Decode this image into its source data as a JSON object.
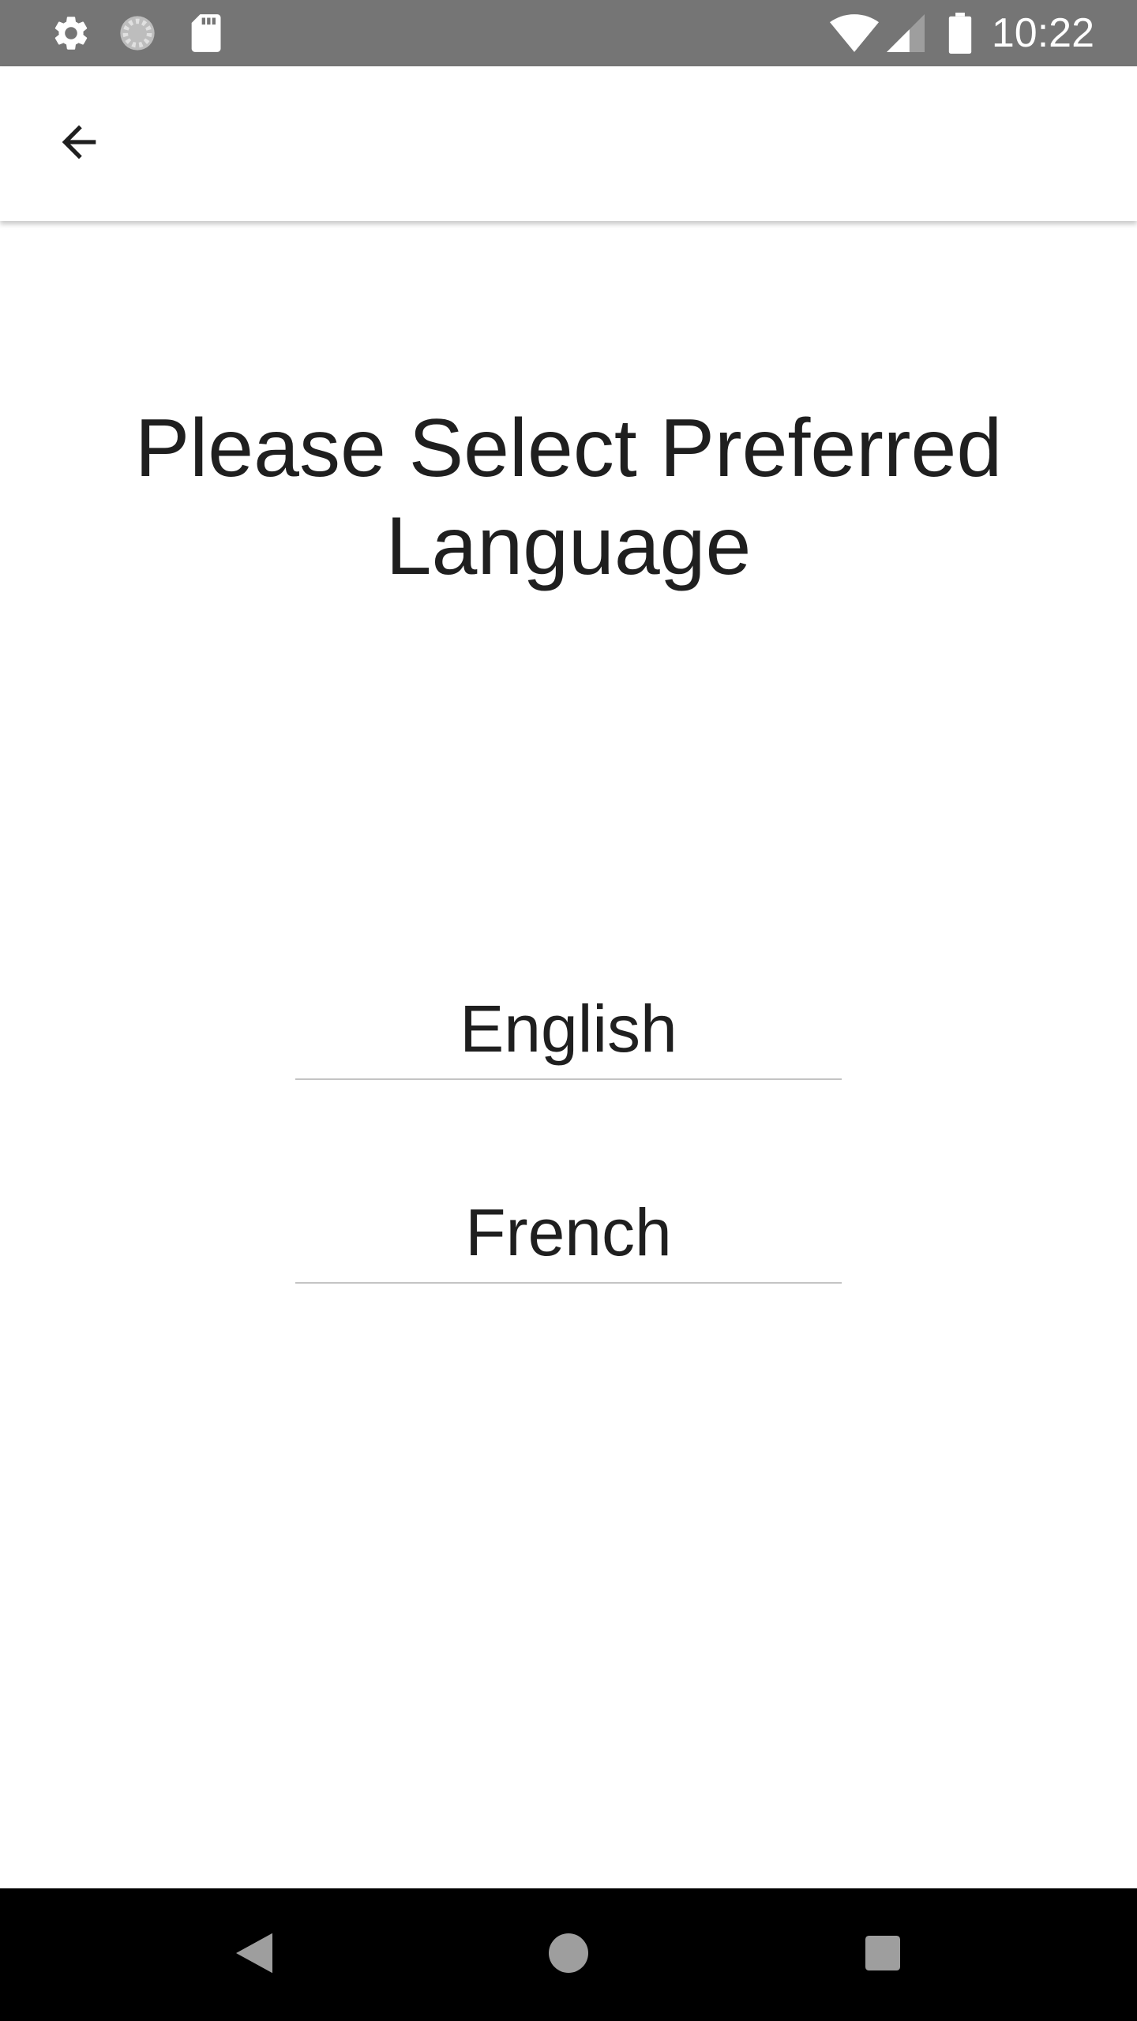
{
  "status_bar": {
    "time": "10:22",
    "left_icons": [
      "gear-icon",
      "sync-spinner-icon",
      "sd-card-icon"
    ],
    "right_icons": [
      "wifi-icon",
      "cell-signal-icon",
      "battery-icon"
    ]
  },
  "app_bar": {
    "back_icon": "arrow-left-icon"
  },
  "main": {
    "title": "Please Select Preferred Language",
    "options": [
      {
        "label": "English"
      },
      {
        "label": "French"
      }
    ]
  },
  "nav_bar": {
    "buttons": [
      "back-triangle-icon",
      "home-circle-icon",
      "recents-square-icon"
    ]
  },
  "colors": {
    "status_bar": "#757575",
    "text": "#1f1f1f",
    "divider": "#c4c4c4",
    "nav_bar": "#000000"
  }
}
